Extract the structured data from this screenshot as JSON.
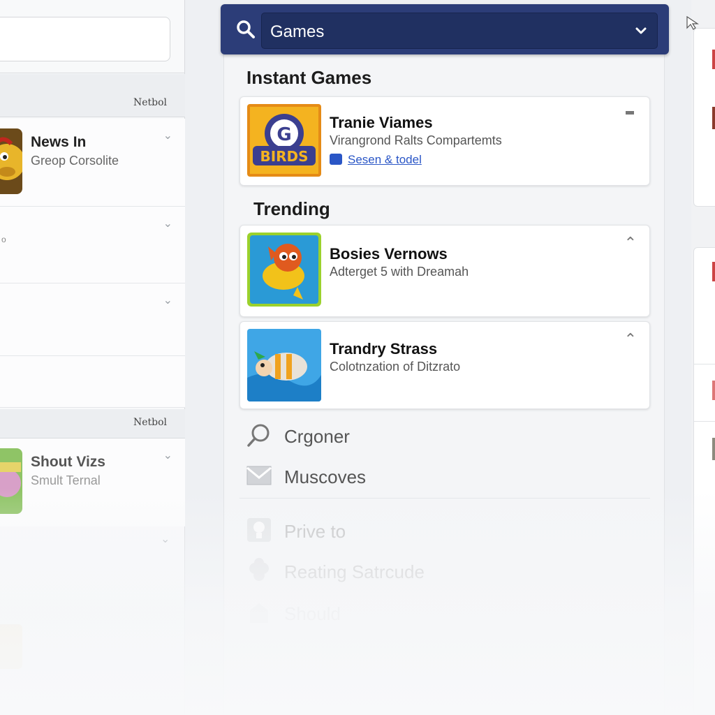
{
  "left_panel": {
    "section1_link": "Netbol",
    "section2_link": "Netbol",
    "rows": [
      {
        "title": "News In",
        "subtitle": "Greop Corsolite"
      },
      {
        "mini": "o"
      }
    ],
    "faded_row": {
      "title": "Shout Vizs",
      "subtitle": "Smult Ternal"
    }
  },
  "search": {
    "query": "Games"
  },
  "instant_games": {
    "heading": "Instant Games",
    "card": {
      "title": "Tranie Viames",
      "subtitle": "Virangrond Ralts Compartemts",
      "link": "Sesen & todel",
      "icon_text": "BIRDS"
    }
  },
  "trending": {
    "heading": "Trending",
    "cards": [
      {
        "title": "Bosies Vernows",
        "subtitle": "Adterget 5 with Dreamah"
      },
      {
        "title": "Trandry Strass",
        "subtitle": "Colotnzation of Ditzrato"
      }
    ]
  },
  "menu": {
    "items": [
      {
        "label": "Crgoner",
        "icon": "search-icon"
      },
      {
        "label": "Muscoves",
        "icon": "envelope-icon"
      }
    ],
    "faded_items": [
      {
        "label": "Prive to",
        "icon": "lightbulb-icon"
      },
      {
        "label": "Reating Satrcude",
        "icon": "clover-icon"
      },
      {
        "label": "Should",
        "icon": "store-icon"
      }
    ]
  },
  "colors": {
    "topbar": "#2c3d78",
    "search_box": "#203061",
    "link": "#2a56c6"
  }
}
